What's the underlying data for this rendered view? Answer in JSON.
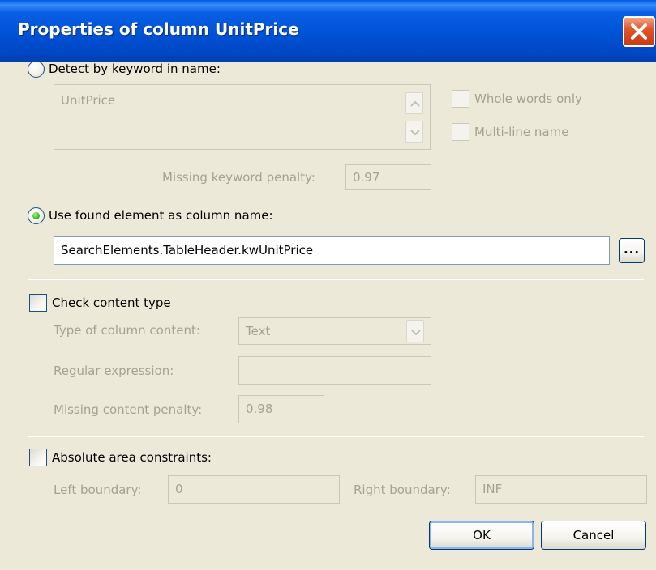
{
  "dialog": {
    "title": "Properties of column UnitPrice",
    "accent": "#0055e5"
  },
  "keyword_section": {
    "radio_label": "Detect by keyword in name:",
    "selected": false,
    "keywords_value": "UnitPrice",
    "whole_words_label": "Whole words only",
    "whole_words_checked": false,
    "multiline_label": "Multi-line name",
    "multiline_checked": false,
    "penalty_label": "Missing keyword penalty:",
    "penalty_value": "0.97"
  },
  "found_element_section": {
    "radio_label": "Use found element as column name:",
    "selected": true,
    "element_value": "SearchElements.TableHeader.kwUnitPrice",
    "browse_label": "..."
  },
  "content_type_section": {
    "checkbox_label": "Check content type",
    "checked": false,
    "type_label": "Type of column content:",
    "type_value": "Text",
    "regex_label": "Regular expression:",
    "regex_value": "",
    "penalty_label": "Missing content penalty:",
    "penalty_value": "0.98"
  },
  "area_section": {
    "checkbox_label": "Absolute area constraints:",
    "checked": false,
    "left_label": "Left boundary:",
    "left_value": "0",
    "right_label": "Right boundary:",
    "right_value": "INF"
  },
  "buttons": {
    "ok": "OK",
    "cancel": "Cancel"
  }
}
